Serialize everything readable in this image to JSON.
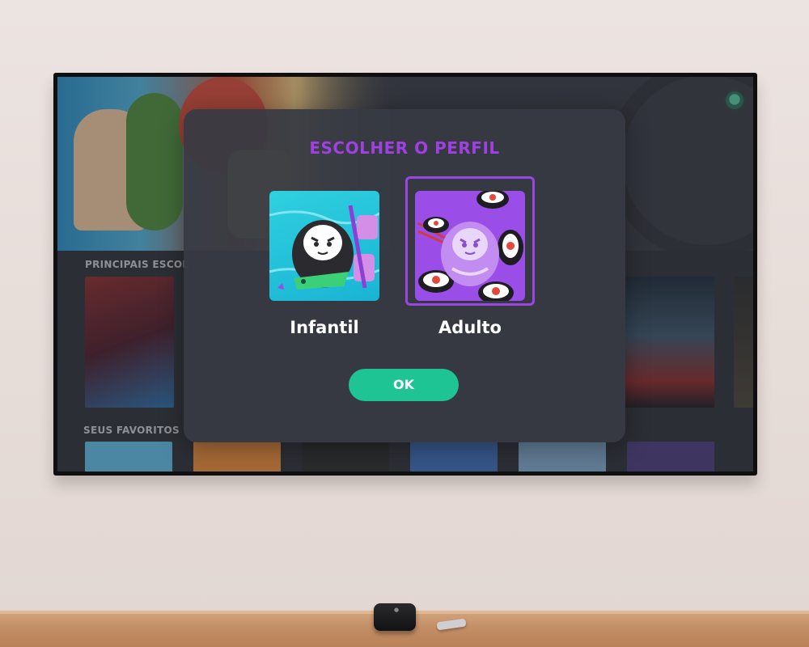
{
  "modal": {
    "title": "ESCOLHER O PERFIL",
    "profiles": [
      {
        "label": "Infantil",
        "selected": false,
        "avatar": "daruma-kid-avatar"
      },
      {
        "label": "Adulto",
        "selected": true,
        "avatar": "daruma-adult-sushi-avatar"
      }
    ],
    "ok_label": "OK"
  },
  "background": {
    "sections": [
      {
        "label": "PRINCIPAIS ESCOL"
      },
      {
        "label": "SEUS FAVORITOS"
      }
    ]
  },
  "colors": {
    "accent_purple": "#9f40e0",
    "ok_green": "#1ec493",
    "modal_bg": "#373a43"
  }
}
